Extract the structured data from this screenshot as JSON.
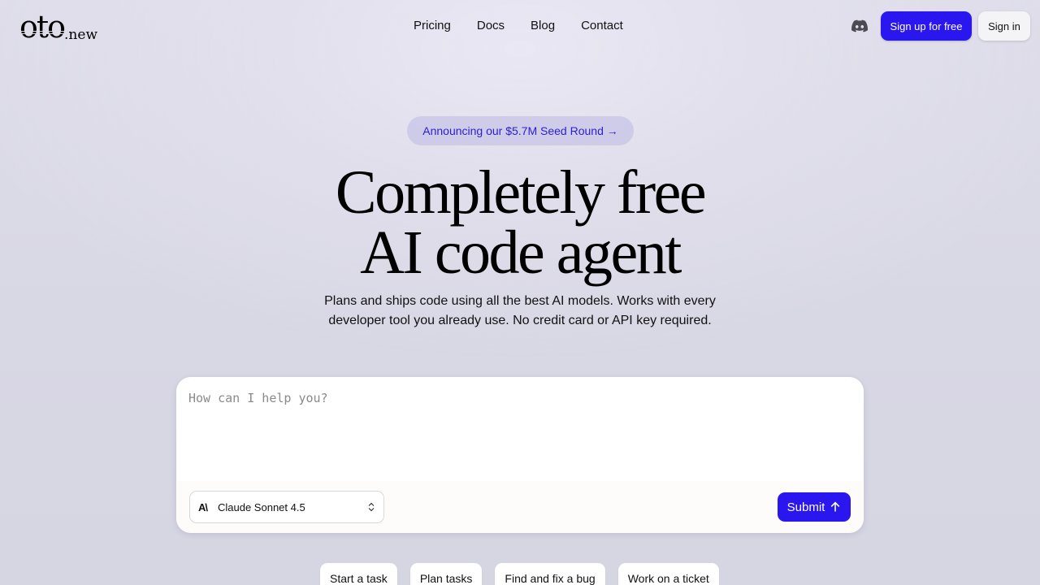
{
  "brand": {
    "logo_main": "oto",
    "logo_suffix": ".new"
  },
  "nav": {
    "items": [
      "Pricing",
      "Docs",
      "Blog",
      "Contact"
    ]
  },
  "header": {
    "discord_icon": "discord-icon",
    "signup_label": "Sign up for free",
    "signin_label": "Sign in"
  },
  "hero": {
    "announcement": "Announcing our $5.7M Seed Round →",
    "headline_line1": "Completely free",
    "headline_line2": "AI code agent",
    "subtitle_line1": "Plans and ships code using all the best AI models. Works with every",
    "subtitle_line2": "developer tool you already use. No credit card or API key required."
  },
  "prompt": {
    "placeholder": "How can I help you?",
    "model_logo": "A\\",
    "model_name": "Claude Sonnet 4.5",
    "submit_label": "Submit"
  },
  "chips": [
    "Start a task",
    "Plan tasks",
    "Find and fix a bug",
    "Work on a ticket"
  ],
  "colors": {
    "accent": "#2a17f0",
    "announce_text": "#2a1fd0"
  }
}
